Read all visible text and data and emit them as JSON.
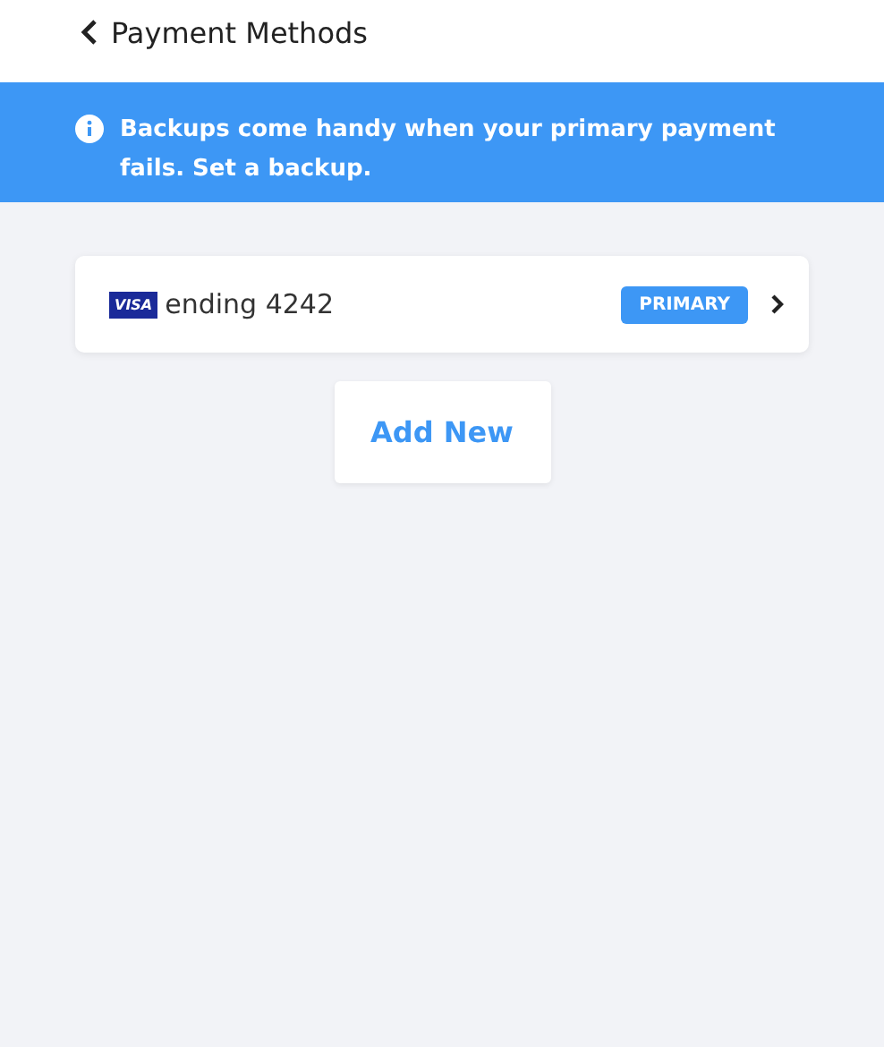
{
  "header": {
    "title": "Payment Methods"
  },
  "banner": {
    "text": "Backups come handy when your primary payment fails. Set a backup."
  },
  "cards": [
    {
      "brand": "VISA",
      "label": "ending 4242",
      "primary": true,
      "badge": "PRIMARY"
    }
  ],
  "add_button": "Add New"
}
